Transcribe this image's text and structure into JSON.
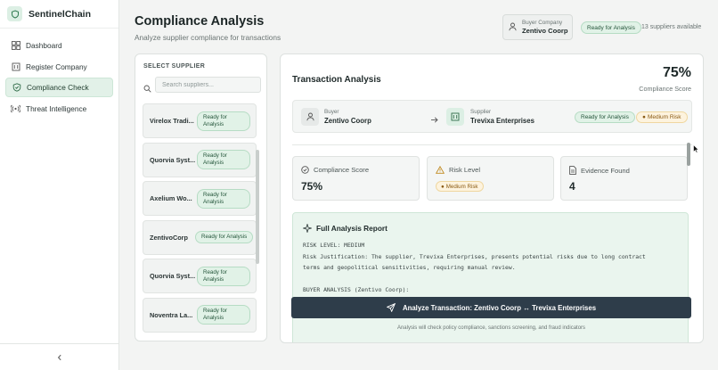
{
  "app": {
    "name": "SentinelChain"
  },
  "sidebar": {
    "items": [
      {
        "label": "Dashboard",
        "icon": "dashboard-icon"
      },
      {
        "label": "Register Company",
        "icon": "building-icon"
      },
      {
        "label": "Compliance Check",
        "icon": "shield-icon",
        "active": true
      },
      {
        "label": "Threat Intelligence",
        "icon": "radar-icon"
      }
    ]
  },
  "header": {
    "title": "Compliance Analysis",
    "subtitle": "Analyze supplier compliance for transactions",
    "buyer_label": "Buyer Company",
    "buyer_name": "Zentivo Coorp",
    "status": "Ready for Analysis",
    "suppliers_available": "13 suppliers available"
  },
  "suppliers": {
    "title": "SELECT SUPPLIER",
    "search_placeholder": "Search suppliers...",
    "items": [
      {
        "name": "Virelox Tradi...",
        "status": "Ready for Analysis"
      },
      {
        "name": "Quorvia Syst...",
        "status": "Ready for Analysis"
      },
      {
        "name": "Axelium Wo...",
        "status": "Ready for Analysis"
      },
      {
        "name": "ZentivoCorp",
        "status": "Ready for Analysis"
      },
      {
        "name": "Quorvia Syst...",
        "status": "Ready for Analysis"
      },
      {
        "name": "Noventra La...",
        "status": "Ready for Analysis"
      }
    ]
  },
  "analysis": {
    "title": "Transaction Analysis",
    "score": "75%",
    "score_label": "Compliance Score",
    "buyer_label": "Buyer",
    "buyer_name": "Zentivo Coorp",
    "supplier_label": "Supplier",
    "supplier_name": "Trevixa Enterprises",
    "status": "Ready for Analysis",
    "risk": "Medium Risk",
    "metrics": {
      "compliance_label": "Compliance Score",
      "compliance_value": "75%",
      "risk_label": "Risk Level",
      "risk_value": "Medium Risk",
      "evidence_label": "Evidence Found",
      "evidence_value": "4"
    },
    "report": {
      "title": "Full Analysis Report",
      "lines": [
        "RISK LEVEL: MEDIUM",
        "Risk Justification: The supplier, Trevixa Enterprises, presents potential risks due to long contract",
        "terms and geopolitical sensitivities, requiring manual review.",
        "",
        "BUYER ANALYSIS (Zentivo Coorp):"
      ]
    },
    "button_label": "Analyze Transaction: Zentivo Coorp ↔ Trevixa Enterprises",
    "footnote": "Analysis will check policy compliance, sanctions screening, and fraud indicators"
  },
  "colors": {
    "accent": "#2e3d4a",
    "ready": "#e1f2e7",
    "medium": "#fdf3de",
    "active_nav": "#e2f1e8"
  }
}
